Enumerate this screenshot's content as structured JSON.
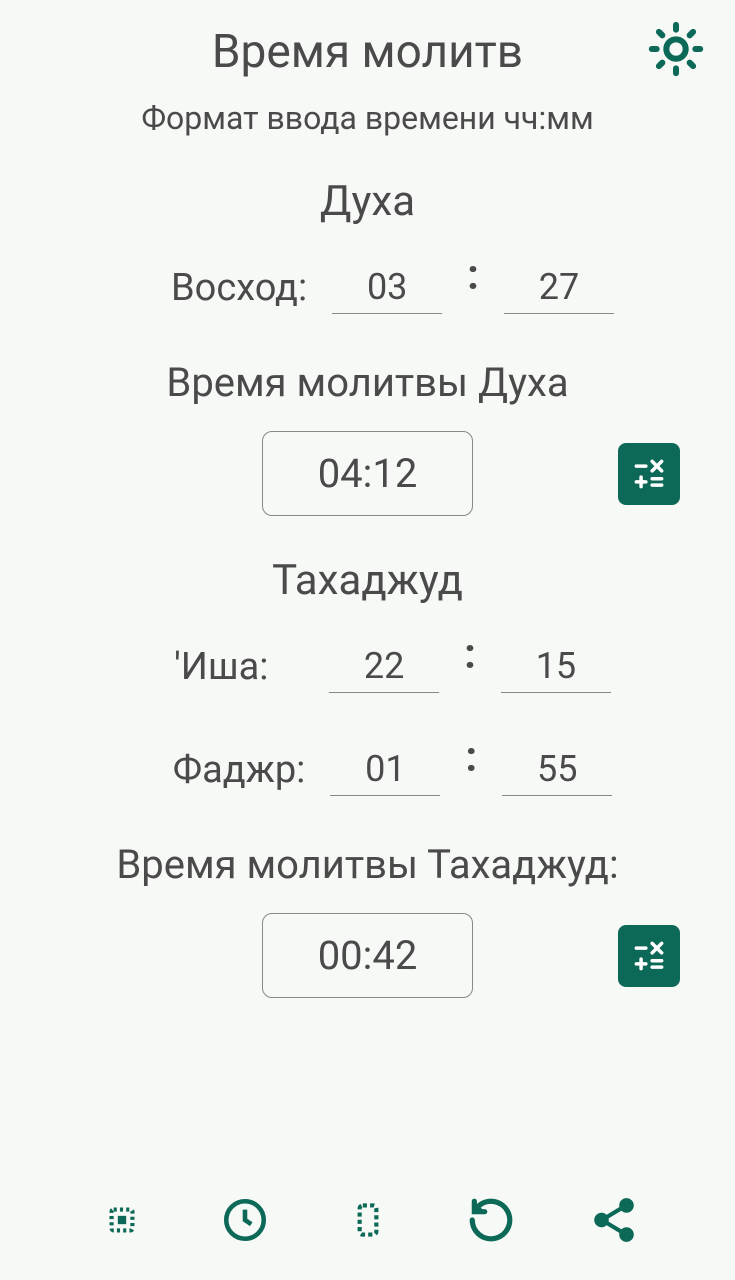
{
  "header": {
    "title": "Время молитв",
    "subtitle": "Формат ввода времени чч:мм"
  },
  "colors": {
    "accent": "#0d6957",
    "text": "#4a4a4a"
  },
  "duha": {
    "section_title": "Духа",
    "sunrise_label": "Восход:",
    "sunrise_hh": "03",
    "sunrise_mm": "27",
    "result_label": "Время молитвы Духа",
    "result_time": "04:12"
  },
  "tahajjud": {
    "section_title": "Тахаджуд",
    "isha_label": "'Иша:",
    "isha_hh": "22",
    "isha_mm": "15",
    "fajr_label": "Фаджр:",
    "fajr_hh": "01",
    "fajr_mm": "55",
    "result_label": "Время молитвы Тахаджуд:",
    "result_time": "00:42"
  }
}
